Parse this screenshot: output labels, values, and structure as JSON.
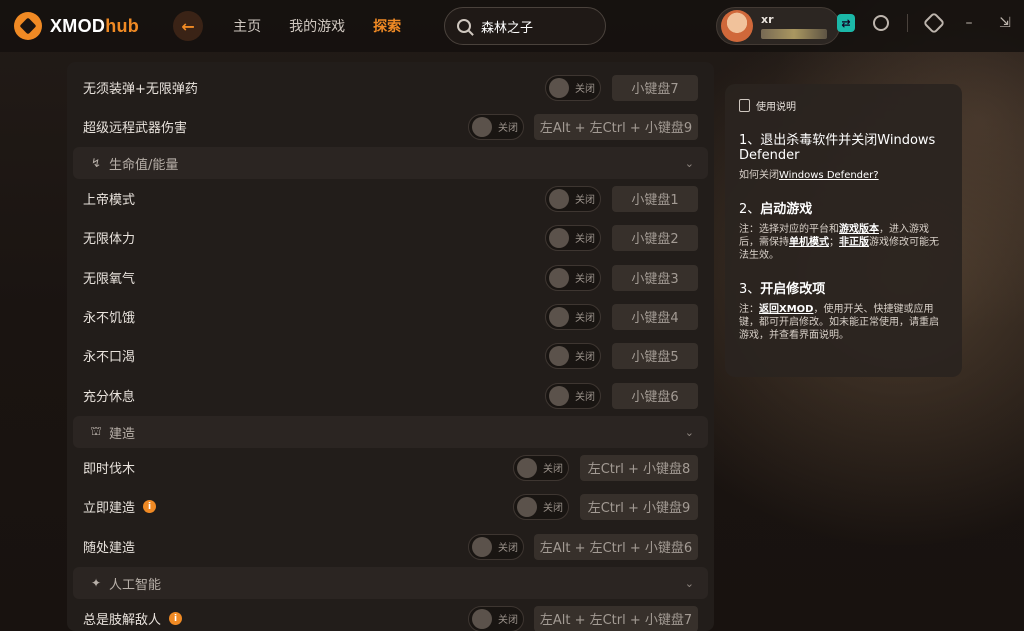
{
  "app": {
    "logo_main": "XMOD",
    "logo_accent": "hub",
    "nav": [
      {
        "label": "主页"
      },
      {
        "label": "我的游戏"
      },
      {
        "label": "探索"
      }
    ],
    "search_value": "森林之子",
    "user_name": "xr"
  },
  "colors": {
    "accent": "#f08a24",
    "teal": "#1bb8a8"
  },
  "toggle_off": "关闭",
  "rows": {
    "r0": {
      "label": "无须装弹+无限弹药",
      "hotkey": "小键盘7",
      "state": "关闭"
    },
    "r1": {
      "label": "超级远程武器伤害",
      "hotkey": "左Alt + 左Ctrl + 小键盘9",
      "state": "关闭"
    },
    "s1": {
      "title": "生命值/能量",
      "icon": "bolt-icon"
    },
    "r2": {
      "label": "上帝模式",
      "hotkey": "小键盘1",
      "state": "关闭"
    },
    "r3": {
      "label": "无限体力",
      "hotkey": "小键盘2",
      "state": "关闭"
    },
    "r4": {
      "label": "无限氧气",
      "hotkey": "小键盘3",
      "state": "关闭"
    },
    "r5": {
      "label": "永不饥饿",
      "hotkey": "小键盘4",
      "state": "关闭"
    },
    "r6": {
      "label": "永不口渴",
      "hotkey": "小键盘5",
      "state": "关闭"
    },
    "r7": {
      "label": "充分休息",
      "hotkey": "小键盘6",
      "state": "关闭"
    },
    "s2": {
      "title": "建造",
      "icon": "building-icon"
    },
    "r8": {
      "label": "即时伐木",
      "hotkey": "左Ctrl + 小键盘8",
      "state": "关闭"
    },
    "r9": {
      "label": "立即建造",
      "hotkey": "左Ctrl + 小键盘9",
      "state": "关闭"
    },
    "r10": {
      "label": "随处建造",
      "hotkey": "左Alt + 左Ctrl + 小键盘6",
      "state": "关闭"
    },
    "s3": {
      "title": "人工智能",
      "icon": "ai-icon"
    },
    "r11": {
      "label": "总是肢解敌人",
      "hotkey": "左Alt + 左Ctrl + 小键盘7",
      "state": "关闭"
    }
  },
  "guide": {
    "header": "使用说明",
    "step1_title": "1、退出杀毒软件并关闭Windows Defender",
    "step1_note_prefix": "如何关闭",
    "step1_note_link": "Windows Defender?",
    "step2_num": "2、",
    "step2_title": "启动游戏",
    "step2_note_a": "注：选择对应的平台和",
    "step2_note_b": "游戏版本",
    "step2_note_c": "，进入游戏后，需保持",
    "step2_note_d": "单机模式",
    "step2_note_e": "；",
    "step2_note_f": "非正版",
    "step2_note_g": "游戏修改可能无法生效。",
    "step3_num": "3、",
    "step3_title": "开启修改项",
    "step3_note_a": "注：",
    "step3_note_b": "返回XMOD",
    "step3_note_c": "，使用开关、快捷键或应用键，都可开启修改。如未能正常使用，请重启游戏，并查看界面说明。"
  }
}
